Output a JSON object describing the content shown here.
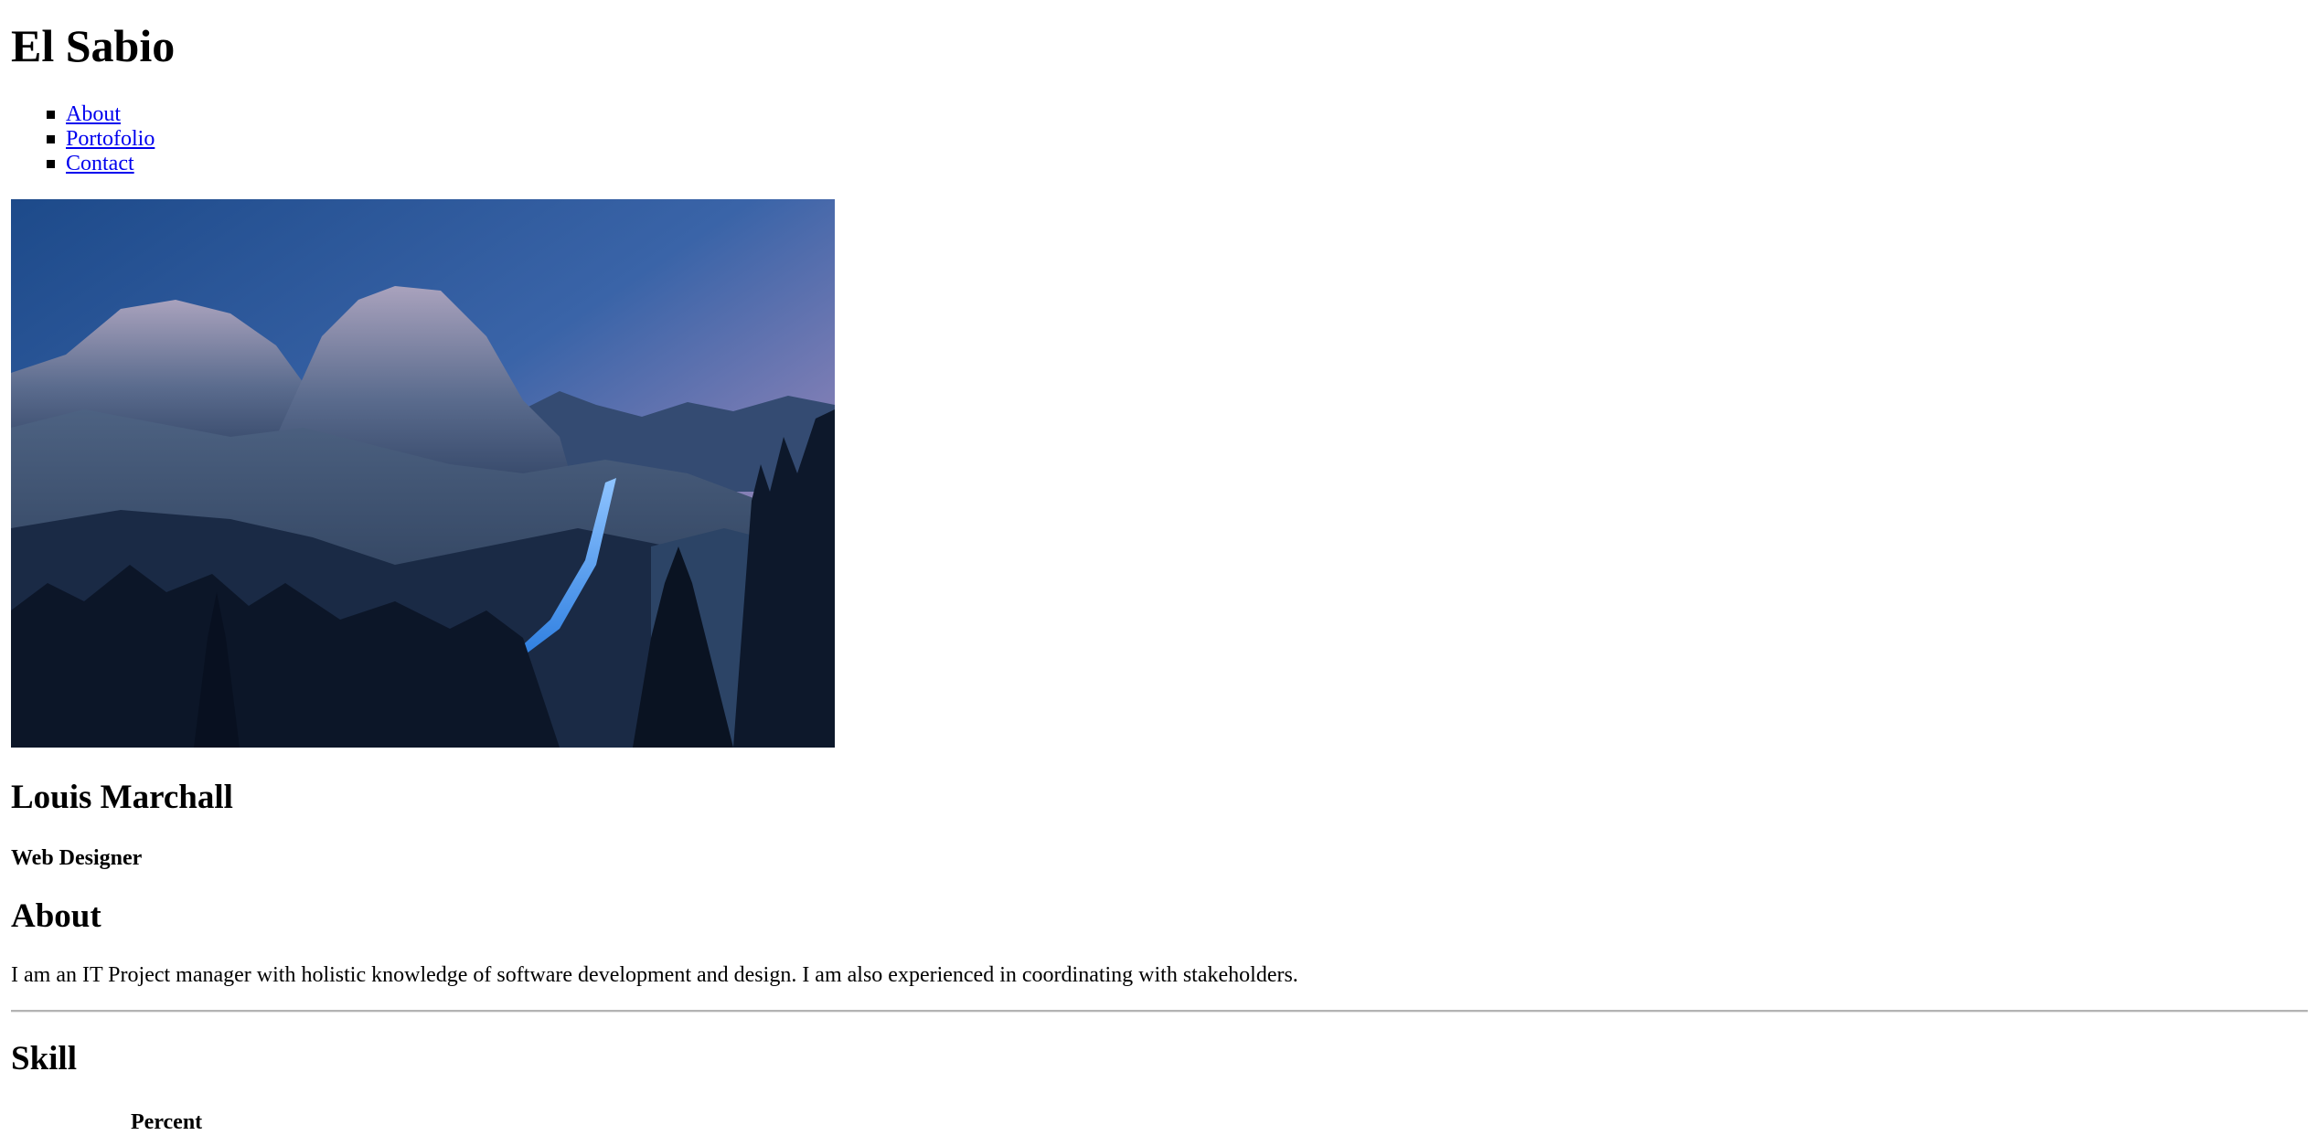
{
  "site": {
    "title": "El Sabio"
  },
  "nav": {
    "items": [
      {
        "label": "About"
      },
      {
        "label": "Portofolio"
      },
      {
        "label": "Contact"
      }
    ]
  },
  "hero": {
    "alt": "Mountain landscape at dusk with a waterfall"
  },
  "profile": {
    "name": "Louis Marchall",
    "role": "Web Designer"
  },
  "about": {
    "heading": "About",
    "text": "I am an IT Project manager with holistic knowledge of software development and design. I am also experienced in coordinating with stakeholders."
  },
  "skill": {
    "heading": "Skill",
    "columns": [
      "",
      "Percent"
    ]
  },
  "colors": {
    "link": "#0000ee",
    "divider": "#b3b3b3"
  }
}
